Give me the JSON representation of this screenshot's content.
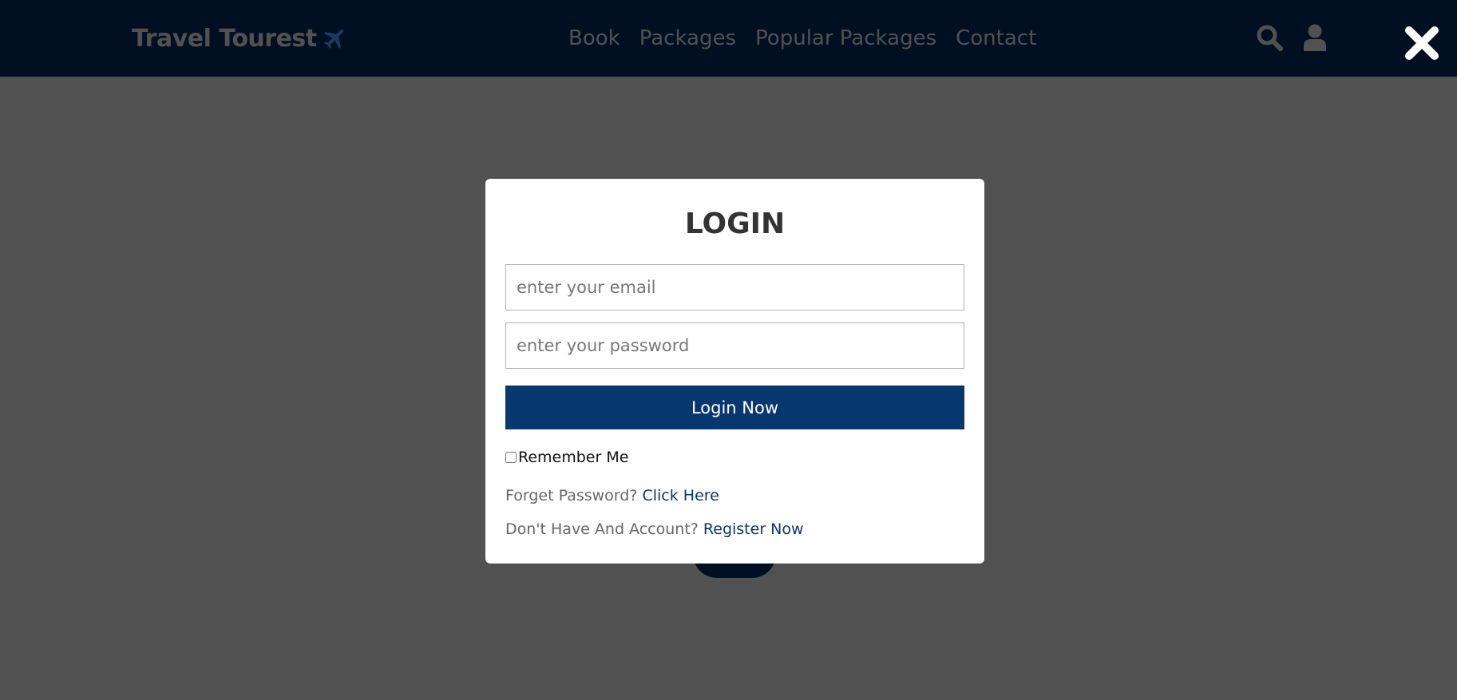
{
  "header": {
    "logo_text": "Travel Tourest",
    "nav": [
      "Book",
      "Packages",
      "Popular Packages",
      "Contact"
    ],
    "icons": [
      "search-icon",
      "user-icon",
      "close-icon"
    ]
  },
  "login": {
    "title": "LOGIN",
    "email_placeholder": "enter your email",
    "password_placeholder": "enter your password",
    "submit_label": "Login Now",
    "remember_label": "Remember Me",
    "remember_checked": false,
    "forgot_text": "Forget Password?",
    "forgot_link": "Click Here",
    "register_text": "Don't Have And Account?",
    "register_link": "Register Now"
  },
  "colors": {
    "navbar": "#001022",
    "overlay": "#515151",
    "accent": "#07376f",
    "modal_bg": "#ffffff"
  }
}
